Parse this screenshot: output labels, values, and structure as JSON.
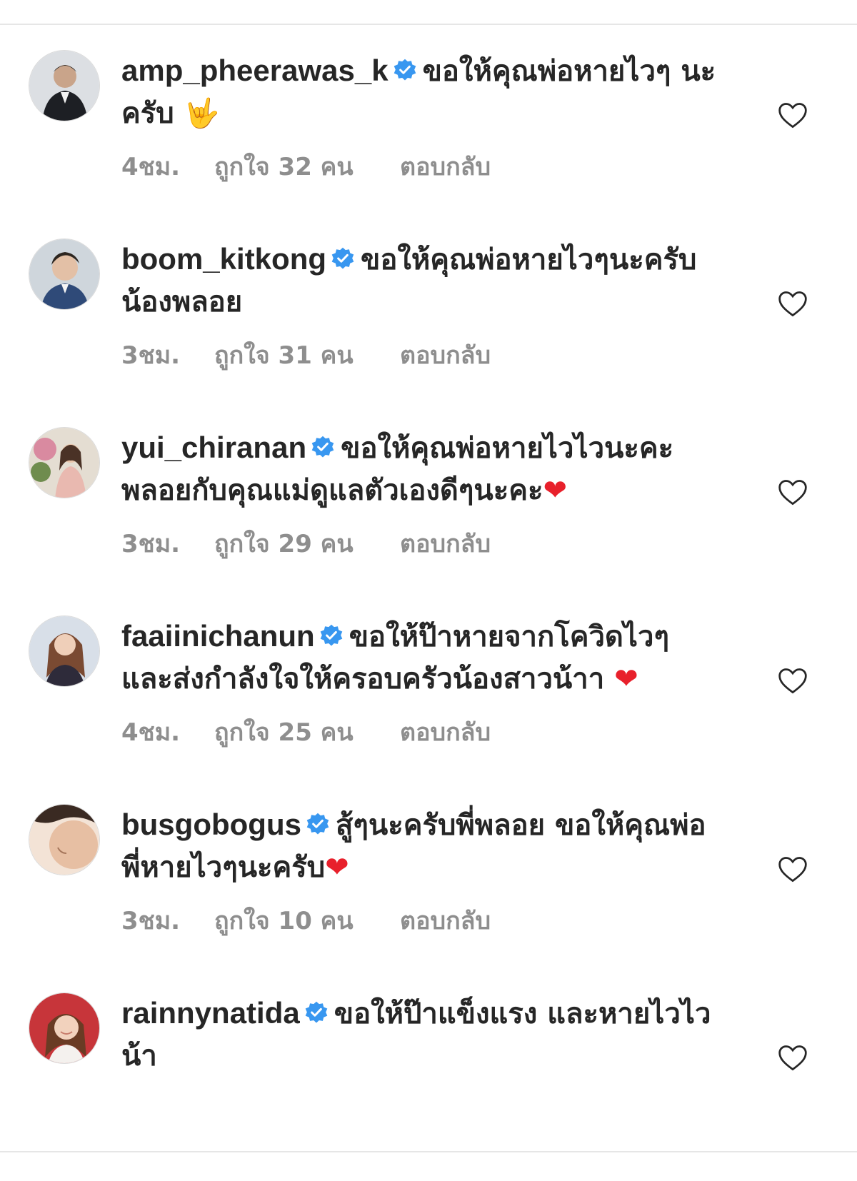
{
  "comments": [
    {
      "username": "amp_pheerawas_k",
      "text": "ขอให้คุณพ่อหายไวๆ นะครับ",
      "emoji": "🤟",
      "time": "4ชม.",
      "likes": "ถูกใจ 32 คน",
      "reply": "ตอบกลับ"
    },
    {
      "username": "boom_kitkong",
      "text": "ขอให้คุณพ่อหายไวๆนะครับน้องพลอย",
      "emoji": "",
      "time": "3ชม.",
      "likes": "ถูกใจ 31 คน",
      "reply": "ตอบกลับ"
    },
    {
      "username": "yui_chiranan",
      "text": "ขอให้คุณพ่อหายไวไวนะคะ พลอยกับคุณแม่ดูแลตัวเองดีๆนะคะ",
      "emoji": "❤",
      "time": "3ชม.",
      "likes": "ถูกใจ 29 คน",
      "reply": "ตอบกลับ"
    },
    {
      "username": "faaiinichanun",
      "text": "ขอให้ป๊าหายจากโควิดไวๆ และส่งกำลังใจให้ครอบครัวน้องสาวน้าา",
      "emoji": "❤",
      "time": "4ชม.",
      "likes": "ถูกใจ 25 คน",
      "reply": "ตอบกลับ"
    },
    {
      "username": "busgobogus",
      "text": "สู้ๆนะครับพี่พลอย ขอให้คุณพ่อพี่หายไวๆนะครับ",
      "emoji": "❤",
      "time": "3ชม.",
      "likes": "ถูกใจ 10 คน",
      "reply": "ตอบกลับ"
    },
    {
      "username": "rainnynatida",
      "text": "ขอให้ป๊าแข็งแรง และหายไวไวน้า",
      "emoji": "",
      "time": "",
      "likes": "",
      "reply": ""
    }
  ],
  "colors": {
    "verified_badge": "#3897f0",
    "text_primary": "#262626",
    "text_secondary": "#8e8e8e",
    "heart_emoji": "#e8202b"
  },
  "icons": {
    "verified": "verified-badge-icon",
    "like": "heart-outline-icon"
  }
}
